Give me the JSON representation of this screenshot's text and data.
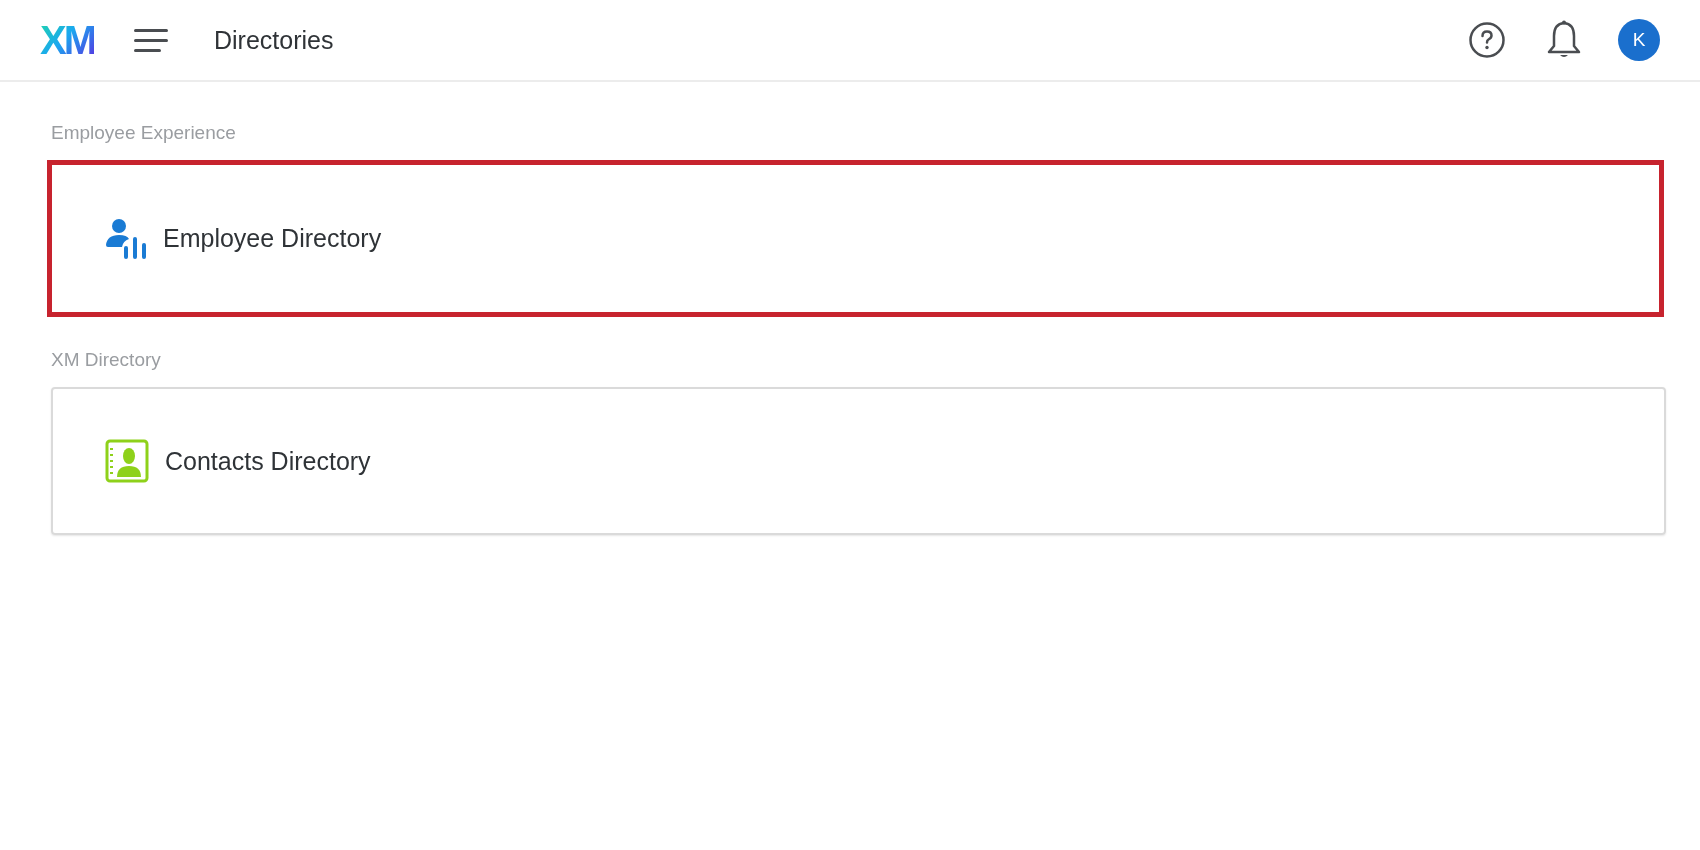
{
  "header": {
    "logo": "XM",
    "title": "Directories",
    "avatar": "K"
  },
  "sections": [
    {
      "label": "Employee Experience",
      "cards": [
        {
          "kind": "employee",
          "title": "Employee Directory",
          "highlighted": true
        }
      ]
    },
    {
      "label": "XM Directory",
      "cards": [
        {
          "kind": "contacts",
          "title": "Contacts Directory",
          "highlighted": false
        }
      ]
    }
  ]
}
